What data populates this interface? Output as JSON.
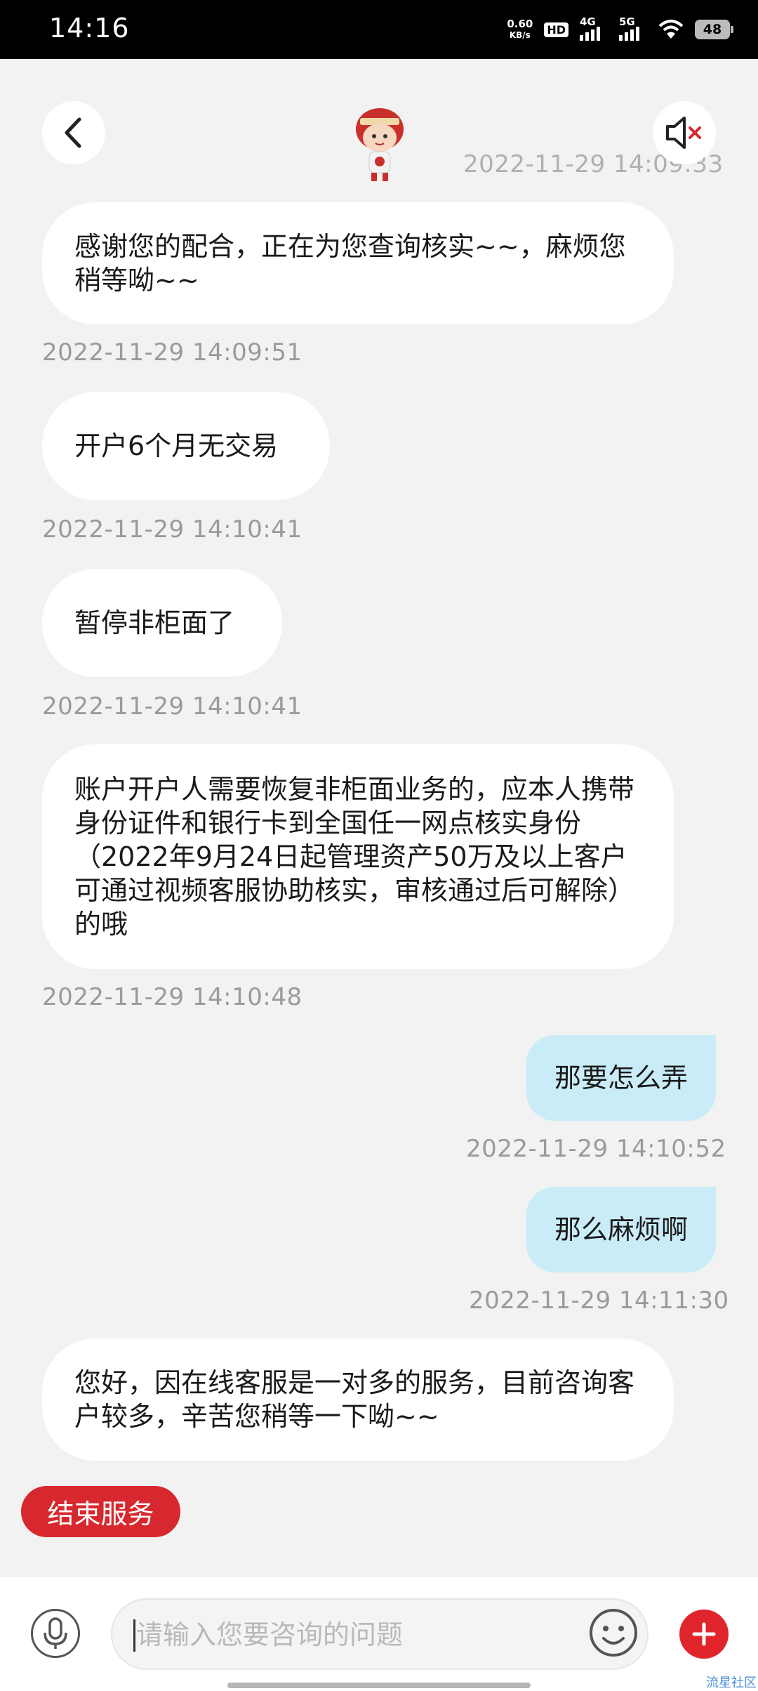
{
  "status_bar": {
    "time": "14:16",
    "net_speed_value": "0.60",
    "net_speed_unit": "KB/s",
    "hd_label": "HD",
    "sim1_label": "4G",
    "sim2_label": "5G",
    "battery": "48"
  },
  "header": {
    "top_timestamp": "2022-11-29 14:09:33"
  },
  "messages": [
    {
      "side": "left",
      "text": "感谢您的配合，正在为您查询核实~~，麻烦您稍等呦~~",
      "time": "2022-11-29 14:09:51"
    },
    {
      "side": "left",
      "text": "开户6个月无交易",
      "time": "2022-11-29 14:10:41"
    },
    {
      "side": "left",
      "text": "暂停非柜面了",
      "time": "2022-11-29 14:10:41"
    },
    {
      "side": "left",
      "text": "账户开户人需要恢复非柜面业务的，应本人携带身份证件和银行卡到全国任一网点核实身份（2022年9月24日起管理资产50万及以上客户可通过视频客服协助核实，审核通过后可解除）的哦",
      "time": "2022-11-29 14:10:48"
    },
    {
      "side": "right",
      "text": "那要怎么弄",
      "time": "2022-11-29 14:10:52"
    },
    {
      "side": "right",
      "text": "那么麻烦啊",
      "time": "2022-11-29 14:11:30"
    },
    {
      "side": "left",
      "text": "您好，因在线客服是一对多的服务，目前咨询客户较多，辛苦您稍等一下呦~~",
      "time": ""
    }
  ],
  "actions": {
    "end_service_label": "结束服务"
  },
  "input": {
    "placeholder": "请输入您要咨询的问题",
    "value": ""
  },
  "watermark": "流星社区",
  "colors": {
    "accent_red": "#d7282f",
    "user_bubble": "#c9ecf8",
    "agent_bubble": "#ffffff",
    "background": "#f2f2f2",
    "timestamp": "#9a9a9a"
  }
}
